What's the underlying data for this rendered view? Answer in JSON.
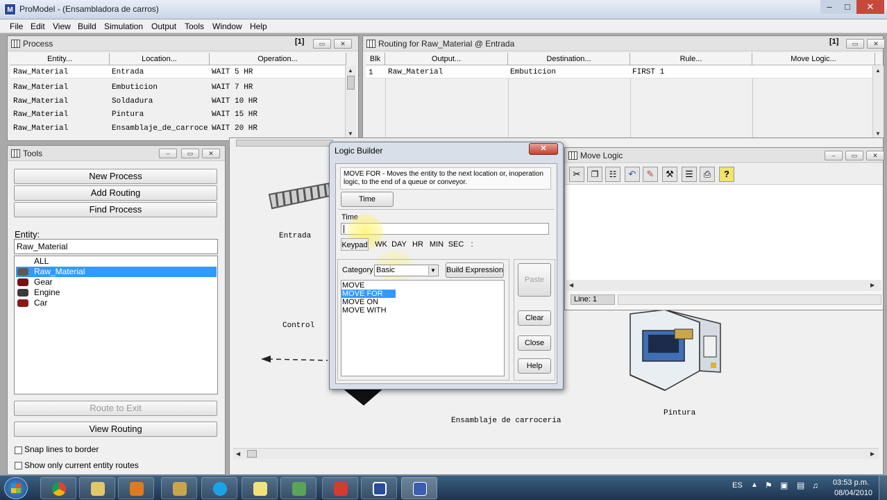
{
  "app": {
    "icon": "promodel-icon",
    "title": "ProModel -  (Ensambladora de carros)"
  },
  "menu": [
    "File",
    "Edit",
    "View",
    "Build",
    "Simulation",
    "Output",
    "Tools",
    "Window",
    "Help"
  ],
  "process": {
    "title": "Process",
    "tag": "[1]",
    "columns": [
      "Entity...",
      "Location...",
      "Operation..."
    ],
    "rows": [
      {
        "entity": "Raw_Material",
        "location": "Entrada",
        "operation": "WAIT 5 HR"
      },
      {
        "entity": "Raw_Material",
        "location": "Embuticion",
        "operation": "WAIT 7 HR"
      },
      {
        "entity": "Raw_Material",
        "location": "Soldadura",
        "operation": "WAIT 10 HR"
      },
      {
        "entity": "Raw_Material",
        "location": "Pintura",
        "operation": "WAIT 15 HR"
      },
      {
        "entity": "Raw_Material",
        "location": "Ensamblaje_de_carroce",
        "operation": "WAIT 20 HR"
      }
    ]
  },
  "routing": {
    "title": "Routing for Raw_Material @ Entrada",
    "tag": "[1]",
    "columns": [
      "Blk",
      "Output...",
      "Destination...",
      "Rule...",
      "Move Logic..."
    ],
    "rows": [
      {
        "blk": "1",
        "output": "Raw_Material",
        "destination": "Embuticion",
        "rule": "FIRST 1",
        "move_logic": ""
      }
    ]
  },
  "tools": {
    "title": "Tools",
    "new_process": "New Process",
    "add_routing": "Add Routing",
    "find_process": "Find Process",
    "entity_label": "Entity:",
    "entity_value": "Raw_Material",
    "entities": [
      "ALL",
      "Raw_Material",
      "Gear",
      "Engine",
      "Car"
    ],
    "route_to_exit": "Route to Exit",
    "view_routing": "View Routing",
    "snap_lines": "Snap lines to border",
    "show_only": "Show only current entity routes"
  },
  "layout": {
    "title": "Layout",
    "labels": {
      "entrada": "Entrada",
      "control": "Control",
      "ensamblaje": "Ensamblaje de carroceria",
      "pintura": "Pintura"
    }
  },
  "move_logic": {
    "title": "Move Logic",
    "toolbar_icons": [
      "cut-icon",
      "copy-icon",
      "paste-icon",
      "undo-icon",
      "highlight-icon",
      "hammer-icon",
      "notes-icon",
      "print-icon",
      "help-icon"
    ],
    "status": "Line: 1"
  },
  "logic_builder": {
    "title": "Logic Builder",
    "description": "MOVE FOR - Moves the entity to the next location or, inoperation logic, to the end of a queue or conveyor.",
    "time_tab": "Time",
    "time_label": "Time",
    "time_value": "",
    "keypad": "Keypad",
    "units": [
      "WK",
      "DAY",
      "HR",
      "MIN",
      "SEC",
      ":"
    ],
    "category_label": "Category",
    "category_value": "Basic",
    "build_expression": "Build Expression",
    "statements": [
      "MOVE",
      "MOVE FOR",
      "MOVE ON",
      "MOVE WITH"
    ],
    "selected_statement": "MOVE FOR",
    "paste": "Paste",
    "clear": "Clear",
    "close": "Close",
    "help": "Help"
  },
  "taskbar": {
    "apps": [
      "chrome-icon",
      "explorer-icon",
      "media-player-icon",
      "folder-icon",
      "skype-icon",
      "notes-icon",
      "network-icon",
      "gmail-icon",
      "app-icon",
      "promodel-icon"
    ],
    "language": "ES",
    "time": "03:53 p.m.",
    "date": "08/04/2010"
  },
  "colors": {
    "selection": "#3399ff",
    "taskbar": "#24405f"
  }
}
